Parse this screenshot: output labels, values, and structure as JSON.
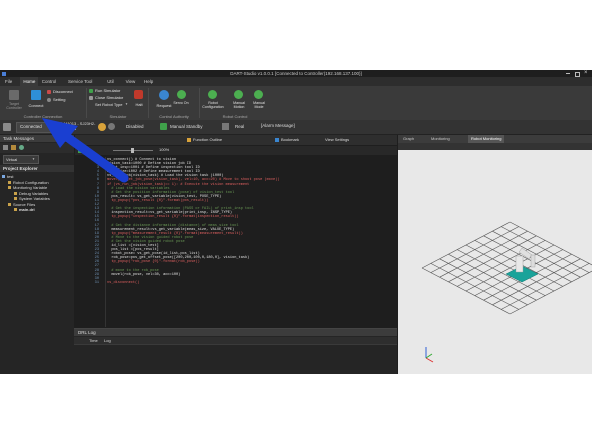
{
  "window": {
    "title": "DART-Studio v1.0.0.1 [Connected to Controller(192.168.137.100)]"
  },
  "menu": [
    "File",
    "Home",
    "Control",
    "Service Tool",
    "Util",
    "View",
    "Help"
  ],
  "ribbon": {
    "controller_connection": {
      "label": "Controller Connection",
      "target_controller": "Target Controller",
      "connect": "Connect",
      "disconnect": "Disconnect",
      "setting": "Setting"
    },
    "simulator": {
      "label": "Simulator",
      "run": "Run Simulator",
      "close": "Close Simulator",
      "set_robot_type": "Set Robot Type",
      "halt": "Halt"
    },
    "control_authority": {
      "label": "Control Authority",
      "request": "Request"
    },
    "robot_control": {
      "label": "Robot Control",
      "servo_on": "Servo On",
      "robot_configuration": "Robot Configuration",
      "manual_motion": "Manual Motion",
      "manual_mode": "Manual Mode"
    }
  },
  "status_bar": {
    "connected": "Connected",
    "model": "M1013 - SJ23H2-M1013",
    "disabled": "Disabled",
    "manual_standby": "Manual Standby",
    "real": "Real",
    "alarm": "[Alarm Message]"
  },
  "left_panel": {
    "tab": "Task Messages",
    "mode": "Virtual",
    "explorer_title": "Project Explorer",
    "tree": [
      {
        "label": "test",
        "level": 0
      },
      {
        "label": "Robot Configuration",
        "level": 1
      },
      {
        "label": "Monitoring Variable",
        "level": 1
      },
      {
        "label": "Debug Variables",
        "level": 2
      },
      {
        "label": "System Variables",
        "level": 2
      },
      {
        "label": "Source Files",
        "level": 1
      },
      {
        "label": "main.drl",
        "level": 2
      }
    ]
  },
  "editor": {
    "function_outline": "Function Outline",
    "bookmark": "Bookmark",
    "view_settings": "View Settings",
    "zoom": "100%",
    "lines": [
      {
        "n": "1",
        "t": "vs_connect() # Connect to vision",
        "c": "#e0e0e0"
      },
      {
        "n": "2",
        "t": "vision_task=1000 # Define vision job ID",
        "c": "#e0e0e0"
      },
      {
        "n": "3",
        "t": "print_insp=1001 # Define inspection tool ID",
        "c": "#e0e0e0"
      },
      {
        "n": "4",
        "t": "meas_size=1002 # Define measurement tool ID",
        "c": "#e0e0e0"
      },
      {
        "n": "5",
        "t": "vs_load_job(vision_task) # Load the vision task (1000)",
        "c": "#e0e0e0"
      },
      {
        "n": "6",
        "t": "movel(vs_get_job_pose(vision_task), vel=10, acc=20) # Move to shoot pose (move))",
        "c": "#e06060"
      },
      {
        "n": "7",
        "t": "if (vs_run_job(vision_task)== 1): # Execute the vision measurement",
        "c": "#e06060"
      },
      {
        "n": "8",
        "t": "  # Load the vision variables",
        "c": "#6a9955"
      },
      {
        "n": "9",
        "t": "  # Get the position information (pose) of vision_test tool",
        "c": "#6a9955"
      },
      {
        "n": "10",
        "t": "  pos_result= vs_get_variable(vision_test, POSE_TYPE)",
        "c": "#e0e0e0"
      },
      {
        "n": "11",
        "t": "  tp_popup(\"pos_result {0}\".format(pos_result))",
        "c": "#e06060"
      },
      {
        "n": "12",
        "t": "",
        "c": "#e0e0e0"
      },
      {
        "n": "13",
        "t": "  # Get the inspection information (PASS or FAIL) of print_insp tool",
        "c": "#6a9955"
      },
      {
        "n": "14",
        "t": "  inspection_result=vs_get_variable(print_insp, INSP_TYPE)",
        "c": "#e0e0e0"
      },
      {
        "n": "15",
        "t": "  tp_popup(\"inspection_result {0}\".format(inspection_result))",
        "c": "#e06060"
      },
      {
        "n": "16",
        "t": "",
        "c": "#e0e0e0"
      },
      {
        "n": "17",
        "t": "  # Get the distance information (distance) of meas_size tool",
        "c": "#6a9955"
      },
      {
        "n": "18",
        "t": "  measurement_result=vs_get_variable(meas_size, VALUE_TYPE)",
        "c": "#e0e0e0"
      },
      {
        "n": "19",
        "t": "  tp_popup(\"measurement_result {0}\".format(measurement_result))",
        "c": "#e06060"
      },
      {
        "n": "20",
        "t": "  # Move to the vision guided robot pose",
        "c": "#6a9955"
      },
      {
        "n": "21",
        "t": "  # Get the vision guided robot pose",
        "c": "#6a9955"
      },
      {
        "n": "22",
        "t": "  id_list =[vision_test]",
        "c": "#e0e0e0"
      },
      {
        "n": "23",
        "t": "  pos_list =[pos_result]",
        "c": "#e0e0e0"
      },
      {
        "n": "24",
        "t": "  robot_pose= vs_get_pose(id_list,pos_list)",
        "c": "#e0e0e0"
      },
      {
        "n": "25",
        "t": "  rob_pose=pos_get_offset_pose([200,200,100,0,180,0], vision_task)",
        "c": "#e0e0e0"
      },
      {
        "n": "26",
        "t": "  tp_popup(\"rob_pose {0}\".format(rob_pose))",
        "c": "#e06060"
      },
      {
        "n": "27",
        "t": "",
        "c": "#e0e0e0"
      },
      {
        "n": "28",
        "t": "  # move to the rob_pose",
        "c": "#6a9955"
      },
      {
        "n": "29",
        "t": "  movel(rob_pose, vel=30, acc=100)",
        "c": "#e0e0e0"
      },
      {
        "n": "30",
        "t": "",
        "c": "#e0e0e0"
      },
      {
        "n": "31",
        "t": "vs_disconnect()",
        "c": "#e06060"
      }
    ]
  },
  "log_panel": {
    "title": "DRL Log",
    "col_time": "Time",
    "col_log": "Log"
  },
  "right_panel": {
    "tabs": [
      "Graph",
      "Monitoring",
      "Robot Monitoring"
    ]
  },
  "colors": {
    "accent": "#2f5fd6",
    "arrow": "#1a3fd1",
    "floor": "#1aa39a"
  }
}
